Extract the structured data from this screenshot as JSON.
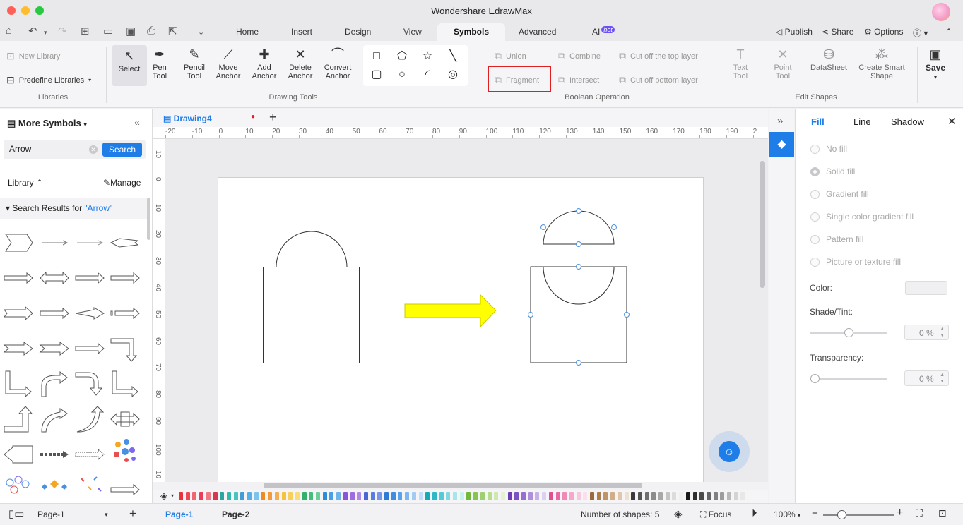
{
  "window": {
    "title": "Wondershare EdrawMax"
  },
  "menu": {
    "tabs": [
      "Home",
      "Insert",
      "Design",
      "View",
      "Symbols",
      "Advanced",
      "AI"
    ],
    "active_tab": "Symbols",
    "ai_badge": "hot",
    "publish": "Publish",
    "share": "Share",
    "options": "Options"
  },
  "ribbon": {
    "libraries": {
      "new_library": "New Library",
      "predefine": "Predefine Libraries",
      "label": "Libraries"
    },
    "drawing_tools": {
      "label": "Drawing Tools",
      "select": "Select",
      "pen": [
        "Pen",
        "Tool"
      ],
      "pencil": [
        "Pencil",
        "Tool"
      ],
      "move_anchor": [
        "Move",
        "Anchor"
      ],
      "add_anchor": [
        "Add",
        "Anchor"
      ],
      "delete_anchor": [
        "Delete",
        "Anchor"
      ],
      "convert_anchor": [
        "Convert",
        "Anchor"
      ]
    },
    "boolean": {
      "label": "Boolean Operation",
      "union": "Union",
      "combine": "Combine",
      "cut_top": "Cut off the top layer",
      "fragment": "Fragment",
      "intersect": "Intersect",
      "cut_bottom": "Cut off bottom layer"
    },
    "edit_shapes": {
      "label": "Edit Shapes",
      "text_tool": [
        "Text",
        "Tool"
      ],
      "point_tool": [
        "Point",
        "Tool"
      ],
      "datasheet": "DataSheet",
      "smart_shape": [
        "Create Smart",
        "Shape"
      ]
    },
    "save": "Save"
  },
  "left_panel": {
    "title": "More Symbols",
    "search_value": "Arrow",
    "search_button": "Search",
    "library_label": "Library",
    "manage": "Manage",
    "results_prefix": "Search Results for",
    "results_keyword": "\"Arrow\""
  },
  "document": {
    "tab_name": "Drawing4"
  },
  "ruler": {
    "h": [
      "-20",
      "-10",
      "0",
      "10",
      "20",
      "30",
      "40",
      "50",
      "60",
      "70",
      "80",
      "90",
      "100",
      "110",
      "120",
      "130",
      "140",
      "150",
      "160",
      "170",
      "180",
      "190",
      "2"
    ],
    "v": [
      "10",
      "0",
      "10",
      "20",
      "30",
      "40",
      "50",
      "60",
      "70",
      "80",
      "90",
      "100",
      "10"
    ]
  },
  "right_panel": {
    "tabs": [
      "Fill",
      "Line",
      "Shadow"
    ],
    "active_tab": "Fill",
    "fill_options": [
      "No fill",
      "Solid fill",
      "Gradient fill",
      "Single color gradient fill",
      "Pattern fill",
      "Picture or texture fill"
    ],
    "selected_option": "Solid fill",
    "color_label": "Color:",
    "shade_label": "Shade/Tint:",
    "shade_value": "0 %",
    "transparency_label": "Transparency:",
    "transparency_value": "0 %",
    "shade_level": 0.5,
    "transparency_level": 0
  },
  "status": {
    "page_select": "Page-1",
    "pages": [
      "Page-1",
      "Page-2"
    ],
    "active_page": "Page-1",
    "shape_count": "Number of shapes: 5",
    "focus": "Focus",
    "zoom": "100%"
  },
  "colors": {
    "accent": "#1f7de8",
    "highlight": "#e02020",
    "arrow_fill": "#ffff00"
  },
  "palette": [
    "#e8323c",
    "#ee4a55",
    "#f2666f",
    "#e8405a",
    "#f07a86",
    "#d6394d",
    "#2aa5a0",
    "#36b6b0",
    "#4ac3bd",
    "#3f9ed8",
    "#56b0e6",
    "#7cc3ee",
    "#f08a24",
    "#f49a3a",
    "#f7ad55",
    "#f5c23a",
    "#f8cf5a",
    "#fadb7a",
    "#33b06a",
    "#47bd7c",
    "#6dcf97",
    "#2e8bd8",
    "#4a9fe3",
    "#6fb3eb",
    "#8a55d6",
    "#9d6ddf",
    "#b089e7",
    "#4966d6",
    "#5a7be0",
    "#7a95e8",
    "#2d7bd6",
    "#3e8de0",
    "#5aa1e8",
    "#7eb6ee",
    "#a2cbf3",
    "#c2ddf7",
    "#18a8b8",
    "#2cb8c6",
    "#55c9d4",
    "#80d8e0",
    "#a7e5ea",
    "#c9f0f3",
    "#72b83a",
    "#86c552",
    "#9ed06f",
    "#b6dc8e",
    "#cfe8b0",
    "#e3f2d0",
    "#6c3fb5",
    "#7e52c2",
    "#9570ce",
    "#ad8fdb",
    "#c6b1e7",
    "#ddd1f2",
    "#e04f8e",
    "#e86aa0",
    "#ef89b5",
    "#f4a9ca",
    "#f8c7dc",
    "#fbe0ec",
    "#9b6b3a",
    "#ad7f4d",
    "#bf9468",
    "#d1ad88",
    "#e1c7aa",
    "#efe0cd",
    "#3a3a3a",
    "#555555",
    "#707070",
    "#8c8c8c",
    "#a8a8a8",
    "#c4c4c4",
    "#dcdcdc",
    "#f0f0f0",
    "#1a1a1a",
    "#2f2f2f",
    "#4a4a4a",
    "#666666",
    "#818181",
    "#9d9d9d",
    "#b9b9b9",
    "#d4d4d4",
    "#e8e8e8",
    "#f5f5f5"
  ]
}
